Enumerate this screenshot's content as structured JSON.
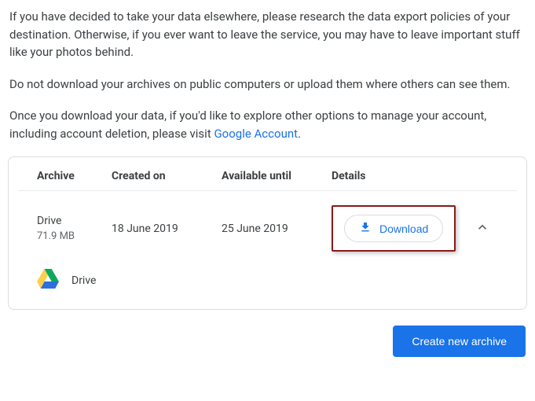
{
  "intro": {
    "p1": "If you have decided to take your data elsewhere, please research the data export policies of your destination. Otherwise, if you ever want to leave the service, you may have to leave important stuff like your photos behind.",
    "p2": "Do not download your archives on public computers or upload them where others can see them.",
    "p3_pre": "Once you download your data, if you'd like to explore other options to manage your account, including account deletion, please visit ",
    "p3_link": "Google Account",
    "p3_post": "."
  },
  "headers": {
    "archive": "Archive",
    "created": "Created on",
    "available": "Available until",
    "details": "Details"
  },
  "row": {
    "name": "Drive",
    "size": "71.9 MB",
    "created": "18 June 2019",
    "available": "25 June 2019",
    "download_label": "Download"
  },
  "product": {
    "name": "Drive"
  },
  "footer": {
    "create_label": "Create new archive"
  }
}
